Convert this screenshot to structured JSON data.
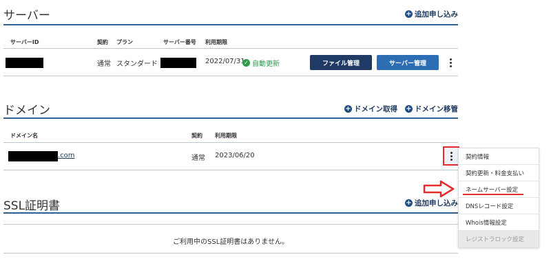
{
  "server": {
    "title": "サーバー",
    "add_label": "追加申し込み",
    "headers": {
      "id": "サーバーID",
      "contract": "契約",
      "plan": "プラン",
      "number": "サーバー番号",
      "expiry": "利用期限"
    },
    "row": {
      "contract": "通常",
      "plan": "スタンダード",
      "expiry": "2022/07/31",
      "renewal": "自動更新",
      "file_btn": "ファイル管理",
      "server_btn": "サーバー管理"
    }
  },
  "domain": {
    "title": "ドメイン",
    "acquire_label": "ドメイン取得",
    "transfer_label": "ドメイン移管",
    "headers": {
      "name": "ドメイン名",
      "contract": "契約",
      "expiry": "利用期限"
    },
    "row": {
      "name_suffix": ".com",
      "contract": "通常",
      "expiry": "2023/06/20"
    }
  },
  "ssl": {
    "title": "SSL証明書",
    "add_label": "追加申し込み",
    "empty_text": "ご利用中のSSL証明書はありません。"
  },
  "menu": {
    "items": [
      "契約情報",
      "契約更新・料金支払い",
      "ネームサーバー設定",
      "DNSレコード設定",
      "Whois情報設定",
      "レジストラロック設定"
    ]
  },
  "colors": {
    "accent": "#2f5f96",
    "dark_button": "#1f3a64",
    "light_button": "#2d6db3",
    "annotation": "#e52b2b",
    "success": "#2e9a4a"
  }
}
